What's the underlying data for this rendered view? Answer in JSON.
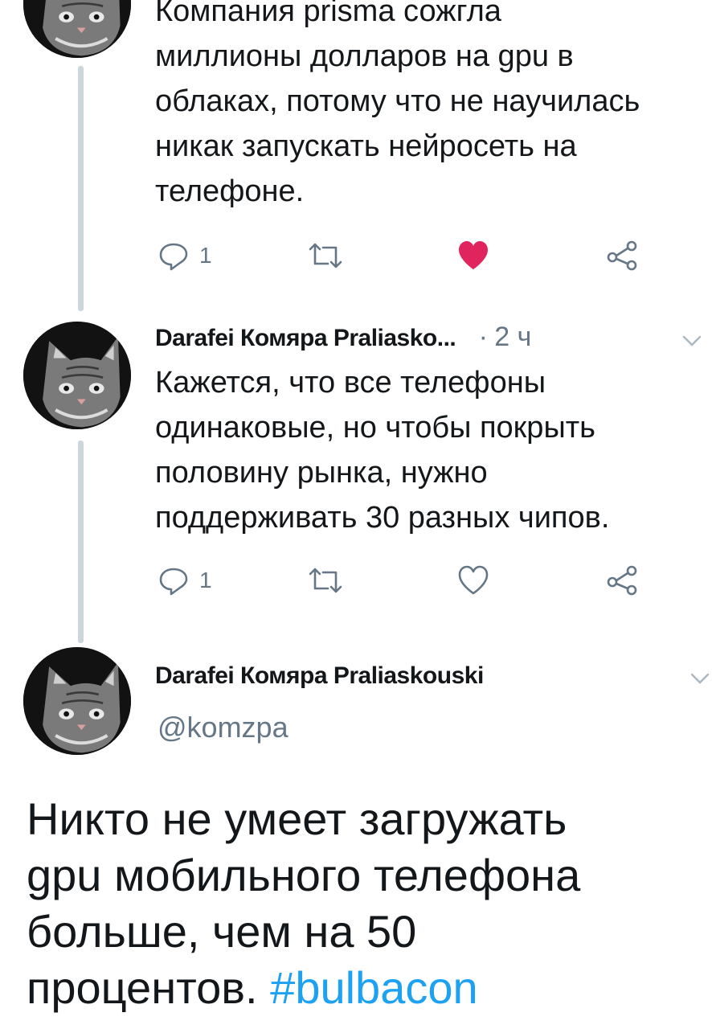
{
  "thread": {
    "tweet1": {
      "lines": [
        "Компания prisma сожгла",
        "миллионы долларов на gpu в",
        "облаках, потому что не научилась",
        "никак запускать нейросеть на",
        "телефоне."
      ],
      "reply_count": "1",
      "liked": true
    },
    "tweet2": {
      "author_name": "Darafei Комяра Praliasko...",
      "separator": "·",
      "time": "2 ч",
      "lines": [
        "Кажется, что все телефоны",
        "одинаковые, но чтобы покрыть",
        "половину рынка, нужно",
        "поддерживать 30 разных чипов."
      ],
      "reply_count": "1",
      "liked": false
    }
  },
  "main_tweet": {
    "author_name": "Darafei Комяра Praliaskouski",
    "handle": "@komzpa",
    "lines": [
      "Никто не умеет загружать",
      "gpu мобильного телефона",
      "больше, чем на 50"
    ],
    "last_line_text": "процентов.",
    "hashtag": "#bulbacon"
  },
  "colors": {
    "like_red": "#e0245e",
    "hashtag_blue": "#1da1f2",
    "icon_gray": "#657786",
    "thread_line": "#ccd6dd"
  },
  "icons": [
    "reply-icon",
    "retweet-icon",
    "like-icon",
    "share-icon",
    "chevron-down-icon",
    "avatar-cat"
  ]
}
